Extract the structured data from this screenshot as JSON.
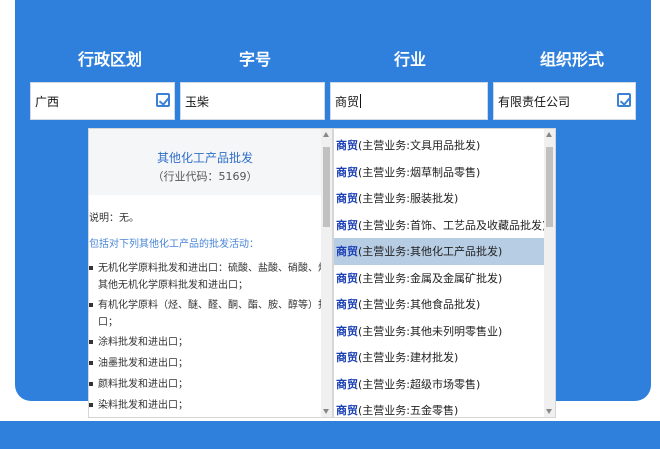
{
  "header": {
    "labels": [
      "行政区划",
      "字号",
      "行业",
      "组织形式"
    ]
  },
  "fields": {
    "region": {
      "value": "广西",
      "icon": "check-icon"
    },
    "trade_name": {
      "value": "玉柴"
    },
    "industry": {
      "value": "商贸"
    },
    "org_form": {
      "value": "有限责任公司",
      "icon": "check-icon"
    }
  },
  "description": {
    "title": "其他化工产品批发",
    "code": "（行业代码：5169）",
    "note": "说明：无。",
    "intro": "包括对下列其他化工产品的批发活动：",
    "lines": [
      "无机化学原料批发和进出口：硫酸、盐酸、硝酸、烧碱、纯碱及",
      "其他无机化学原料批发和进出口；",
      "有机化学原料（烃、醚、醛、酮、酯、胺、醇等）批发和进出",
      "口；",
      "涂料批发和进出口；",
      "油墨批发和进出口；",
      "颜料批发和进出口；",
      "染料批发和进出口；"
    ]
  },
  "suggestions": {
    "keyword": "商贸",
    "items": [
      "(主营业务:文具用品批发)",
      "(主营业务:烟草制品零售)",
      "(主营业务:服装批发)",
      "(主营业务:首饰、工艺品及收藏品批发)",
      "(主营业务:其他化工产品批发)",
      "(主营业务:金属及金属矿批发)",
      "(主营业务:其他食品批发)",
      "(主营业务:其他未列明零售业)",
      "(主营业务:建材批发)",
      "(主营业务:超级市场零售)",
      "(主营业务:五金零售)"
    ],
    "selected_index": 4
  },
  "colors": {
    "brand": "#2f80dd",
    "highlight": "#b7cde4",
    "keyword": "#1a3fb5"
  }
}
